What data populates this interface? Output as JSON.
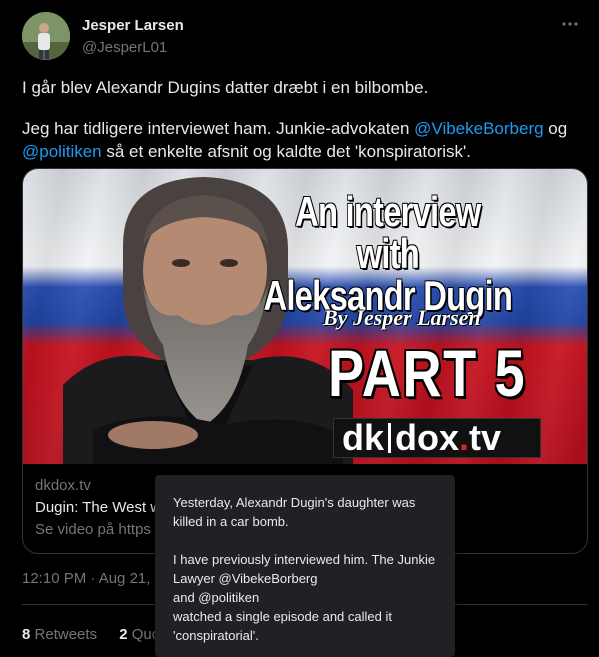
{
  "author": {
    "display_name": "Jesper Larsen",
    "handle": "@JesperL01"
  },
  "tweet": {
    "line1": "I går blev Alexandr Dugins datter dræbt i en bilbombe.",
    "line2_prefix": "Jeg har tidligere interviewet ham. Junkie-advokaten ",
    "mention1": "@VibekeBorberg",
    "line2_og": " og",
    "mention2": "@politiken",
    "line2_suffix": " så et enkelte afsnit og kaldte det 'konspiratorisk'."
  },
  "card": {
    "media": {
      "title_line1": "An interview with",
      "title_line2": "Aleksandr Dugin",
      "byline": "By Jesper Larsen",
      "part": "PART  5",
      "logo_dk": "dk",
      "logo_dox": "dox",
      "logo_dot": ".",
      "logo_tv": "tv"
    },
    "domain": "dkdox.tv",
    "title": "Dugin: The West w",
    "subtitle": "Se video på https"
  },
  "meta": {
    "time": "12:10 PM · Aug 21, 2"
  },
  "stats": {
    "retweets_count": "8",
    "retweets_label": "Retweets",
    "quotes_count": "2",
    "quotes_label": "Quo"
  },
  "tooltip": {
    "p1": "Yesterday, Alexandr Dugin's daughter was killed in a car bomb.",
    "p2a": "I have previously interviewed him. The Junkie Lawyer @VibekeBorberg",
    "p2b": "and @politiken",
    "p2c": "watched a single episode and called it 'conspiratorial'."
  },
  "icons": {
    "more": "more-dots-icon"
  },
  "colors": {
    "background": "#000000",
    "accent": "#1d9bf0",
    "muted": "#71767b",
    "text": "#e7e9ea"
  }
}
